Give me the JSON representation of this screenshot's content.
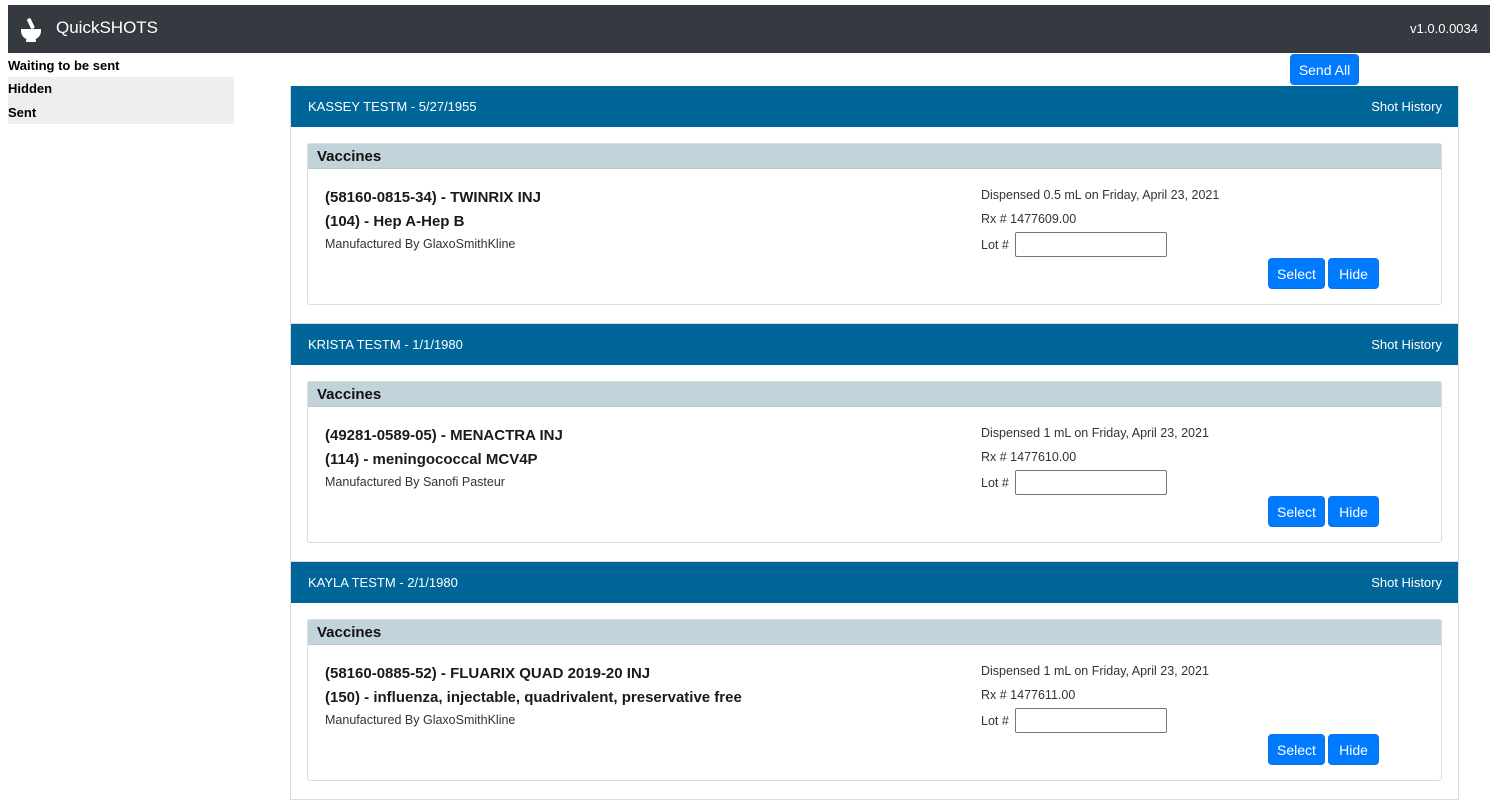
{
  "app": {
    "title": "QuickSHOTS",
    "version": "v1.0.0.0034",
    "logo_icon": "mortar-pestle-icon"
  },
  "sidebar": {
    "items": [
      {
        "label": "Waiting to be sent",
        "active": true
      },
      {
        "label": "Hidden",
        "active": false
      },
      {
        "label": "Sent",
        "active": false
      }
    ]
  },
  "toolbar": {
    "send_all_label": "Send All"
  },
  "patients": [
    {
      "name_dob": "KASSEY TESTM - 5/27/1955",
      "shot_history_label": "Shot History",
      "vaccines_title": "Vaccines",
      "ndc_line": "(58160-0815-34) - TWINRIX INJ",
      "cvx_line": "(104) - Hep A-Hep B",
      "manufacturer": "Manufactured By GlaxoSmithKline",
      "dispensed": "Dispensed 0.5 mL on Friday, April 23, 2021",
      "rx": "Rx # 1477609.00",
      "lot_label": "Lot #",
      "lot_value": "",
      "select_label": "Select",
      "hide_label": "Hide"
    },
    {
      "name_dob": "KRISTA TESTM - 1/1/1980",
      "shot_history_label": "Shot History",
      "vaccines_title": "Vaccines",
      "ndc_line": "(49281-0589-05) - MENACTRA INJ",
      "cvx_line": "(114) - meningococcal MCV4P",
      "manufacturer": "Manufactured By Sanofi Pasteur",
      "dispensed": "Dispensed 1 mL on Friday, April 23, 2021",
      "rx": "Rx # 1477610.00",
      "lot_label": "Lot #",
      "lot_value": "",
      "select_label": "Select",
      "hide_label": "Hide"
    },
    {
      "name_dob": "KAYLA TESTM - 2/1/1980",
      "shot_history_label": "Shot History",
      "vaccines_title": "Vaccines",
      "ndc_line": "(58160-0885-52) - FLUARIX QUAD 2019-20 INJ",
      "cvx_line": "(150) - influenza, injectable, quadrivalent, preservative free",
      "manufacturer": "Manufactured By GlaxoSmithKline",
      "dispensed": "Dispensed 1 mL on Friday, April 23, 2021",
      "rx": "Rx # 1477611.00",
      "lot_label": "Lot #",
      "lot_value": "",
      "select_label": "Select",
      "hide_label": "Hide"
    }
  ],
  "colors": {
    "navbar": "#343a40",
    "patient_header": "#006699",
    "vaccines_header": "#c3d3da",
    "primary_button": "#007bff"
  }
}
